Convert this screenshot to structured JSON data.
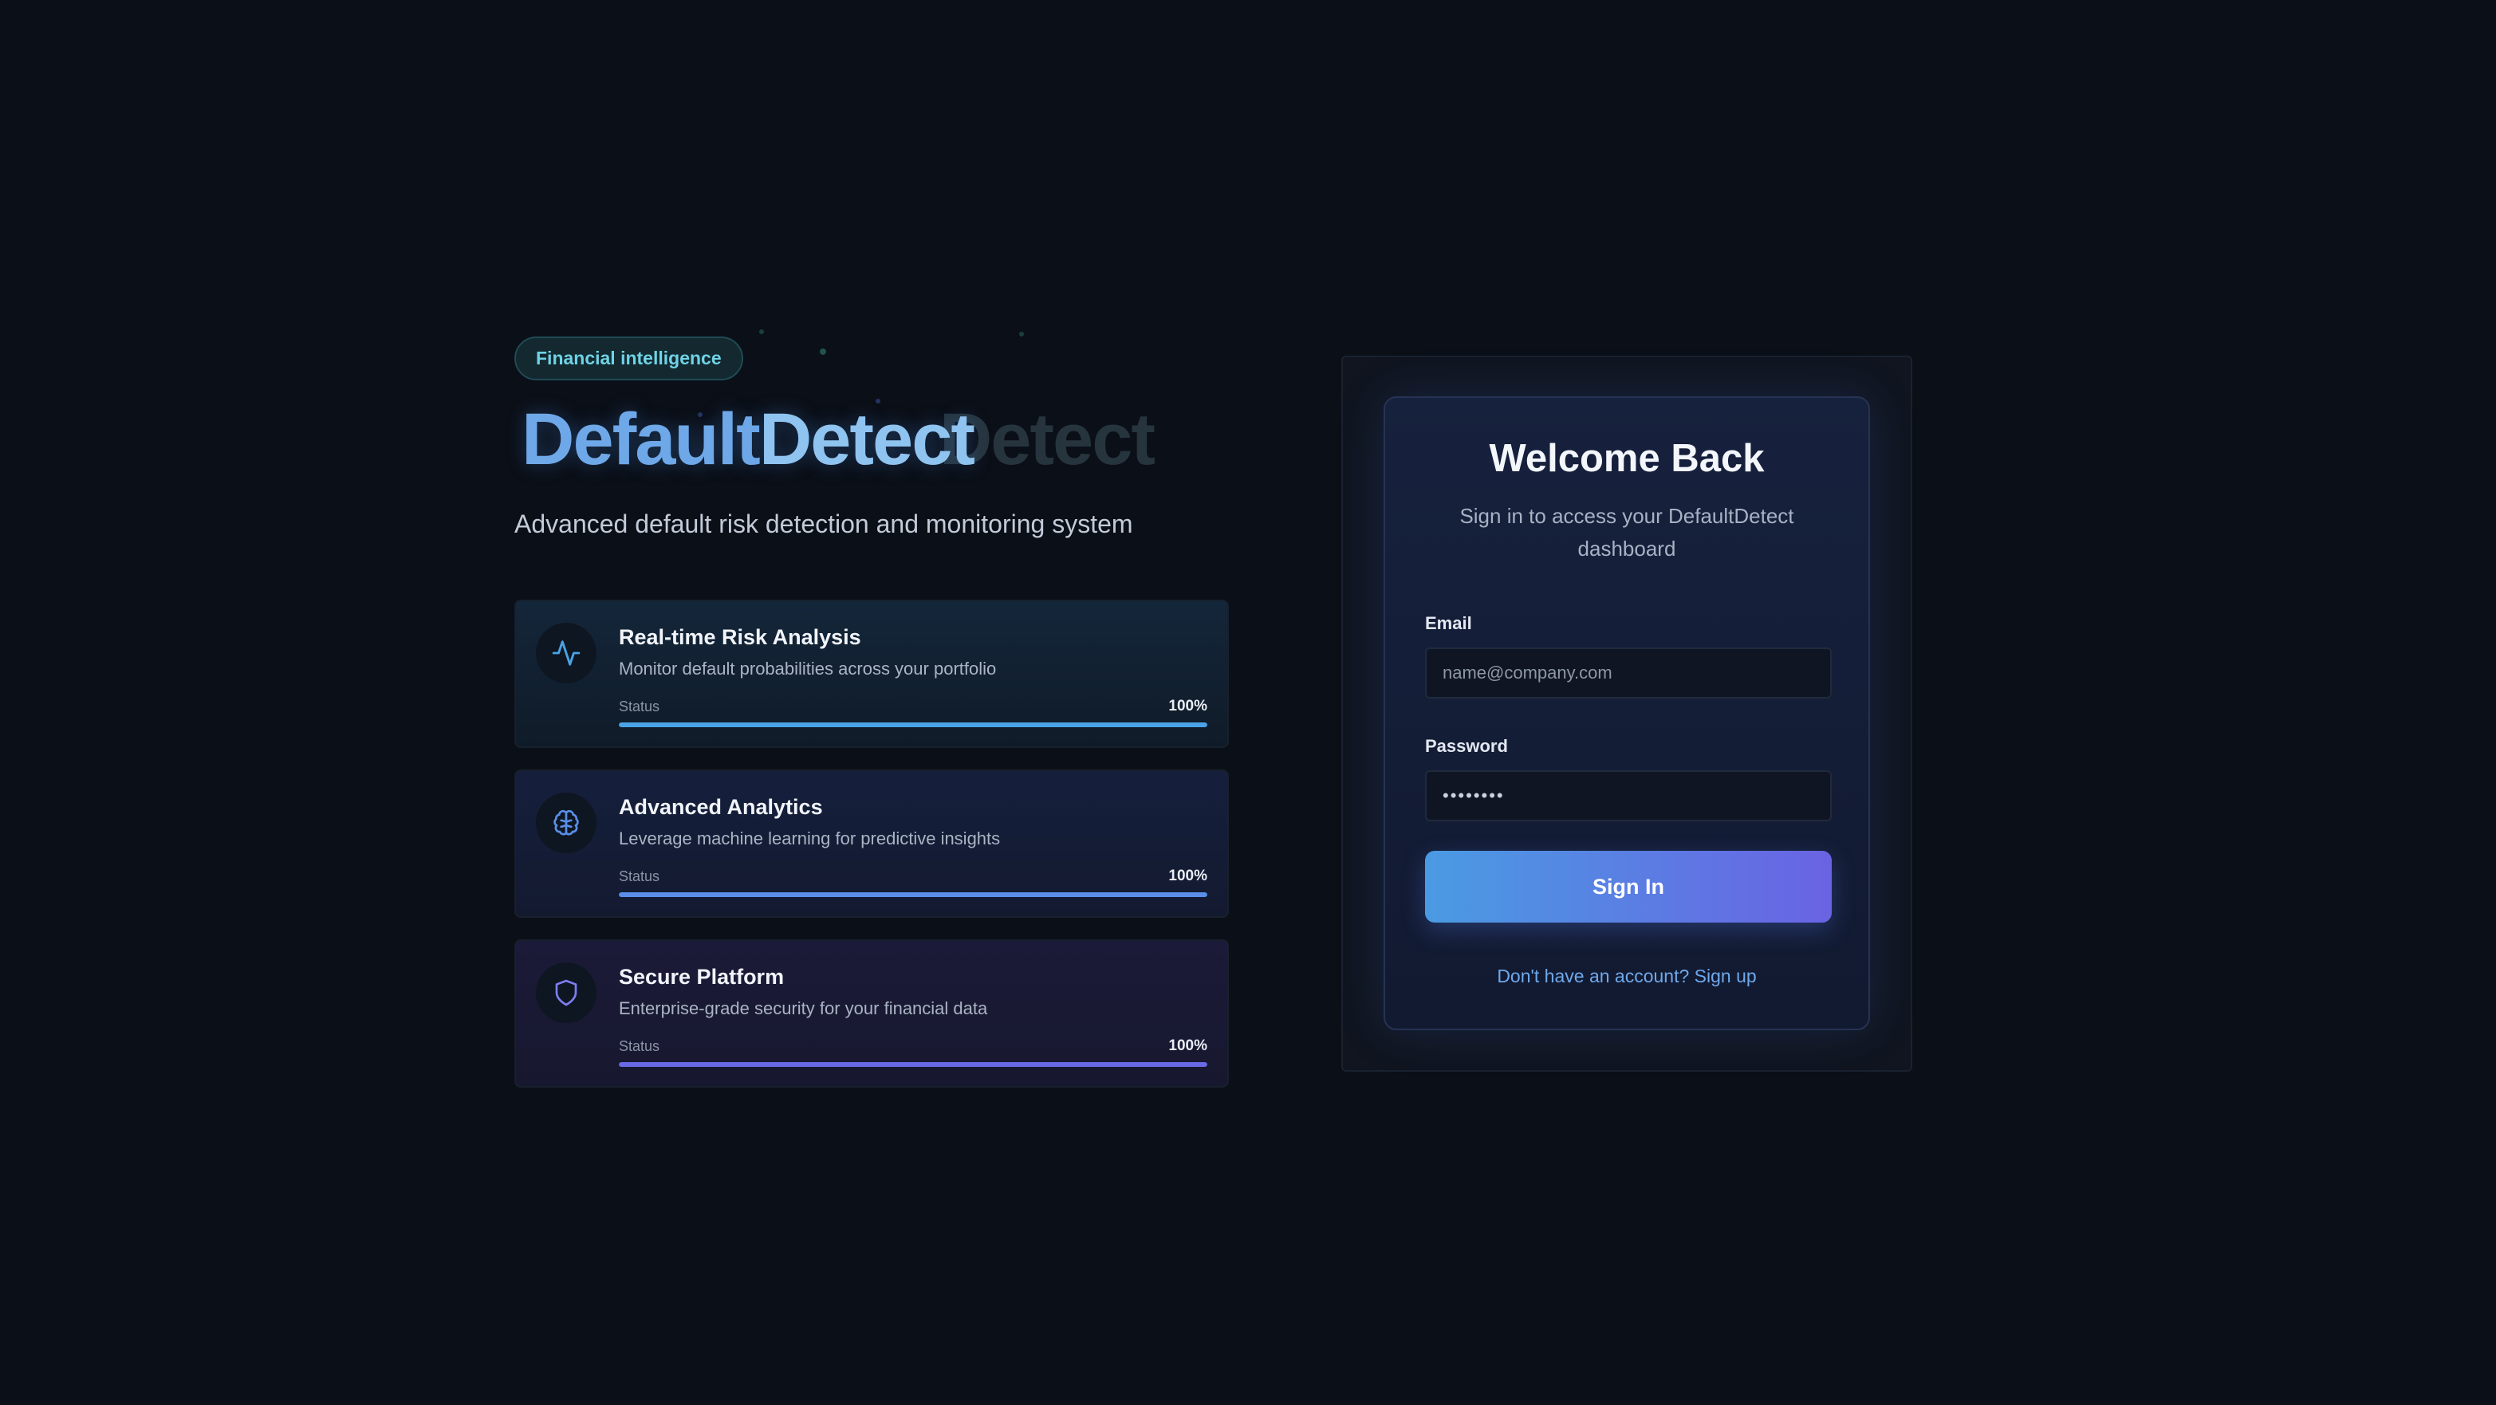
{
  "hero": {
    "badge": "Financial intelligence",
    "brand_part1": "Default",
    "brand_part2": "Detect",
    "brand_ghost": "Detect",
    "subtitle": "Advanced default risk detection and monitoring system"
  },
  "features": [
    {
      "icon": "activity-pulse-icon",
      "title": "Real-time Risk Analysis",
      "description": "Monitor default probabilities across your portfolio",
      "status_label": "Status",
      "status_value": "100%",
      "progress": 1.0,
      "color": "#4aa3e6"
    },
    {
      "icon": "brain-icon",
      "title": "Advanced Analytics",
      "description": "Leverage machine learning for predictive insights",
      "status_label": "Status",
      "status_value": "100%",
      "progress": 1.0,
      "color": "#5a8ee8"
    },
    {
      "icon": "shield-icon",
      "title": "Secure Platform",
      "description": "Enterprise-grade security for your financial data",
      "status_label": "Status",
      "status_value": "100%",
      "progress": 1.0,
      "color": "#6a6ae6"
    }
  ],
  "login": {
    "title": "Welcome Back",
    "subtitle": "Sign in to access your DefaultDetect dashboard",
    "email_label": "Email",
    "email_placeholder": "name@company.com",
    "password_label": "Password",
    "password_value": "••••••••",
    "submit_label": "Sign In",
    "signup_text": "Don't have an account? Sign up"
  },
  "colors": {
    "background": "#0b0f17",
    "accent_start": "#4a9be3",
    "accent_end": "#6a63e3",
    "badge_text": "#6fd3e6"
  }
}
